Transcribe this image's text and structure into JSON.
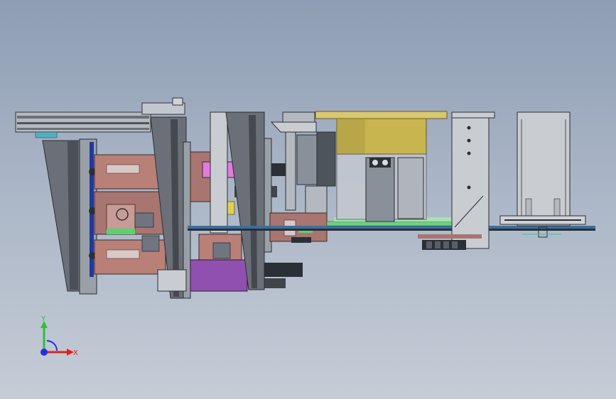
{
  "viewport": {
    "background_top": "#8e9db3",
    "background_bottom": "#c5ccd6"
  },
  "triad": {
    "y_label": "Y",
    "x_label": "X",
    "y_color": "#2fbf3a",
    "x_color": "#e02020",
    "z_color": "#2030e0"
  },
  "colors": {
    "steel": "#9aa0a8",
    "dark_steel": "#5d636b",
    "salmon": "#b98078",
    "magenta": "#d070c8",
    "purple": "#9050b0",
    "gold": "#d9c870",
    "green": "#6fd080",
    "blue_rail": "#2038a0",
    "light_panel": "#c9ccd0"
  }
}
